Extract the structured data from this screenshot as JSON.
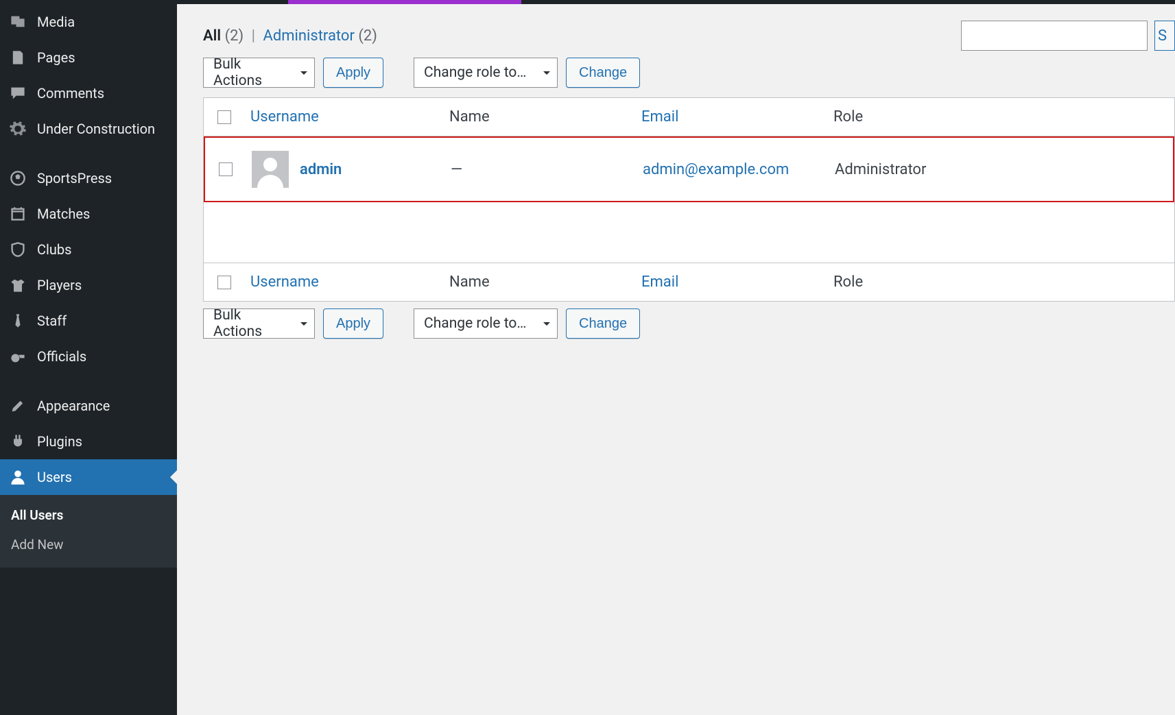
{
  "sidebar": {
    "items": [
      {
        "label": "Media"
      },
      {
        "label": "Pages"
      },
      {
        "label": "Comments"
      },
      {
        "label": "Under Construction"
      },
      {
        "label": "SportsPress"
      },
      {
        "label": "Matches"
      },
      {
        "label": "Clubs"
      },
      {
        "label": "Players"
      },
      {
        "label": "Staff"
      },
      {
        "label": "Officials"
      },
      {
        "label": "Appearance"
      },
      {
        "label": "Plugins"
      },
      {
        "label": "Users"
      }
    ],
    "submenu": [
      {
        "label": "All Users",
        "active": true
      },
      {
        "label": "Add New",
        "active": false
      }
    ]
  },
  "filters": {
    "all_label": "All",
    "all_count": "(2)",
    "admin_label": "Administrator",
    "admin_count": "(2)"
  },
  "controls": {
    "bulk": "Bulk Actions",
    "apply": "Apply",
    "role": "Change role to…",
    "change": "Change",
    "search_stub": "S"
  },
  "table": {
    "cols": {
      "username": "Username",
      "name": "Name",
      "email": "Email",
      "role": "Role"
    },
    "row": {
      "username": "admin",
      "name": "—",
      "email": "admin@example.com",
      "role": "Administrator"
    }
  }
}
